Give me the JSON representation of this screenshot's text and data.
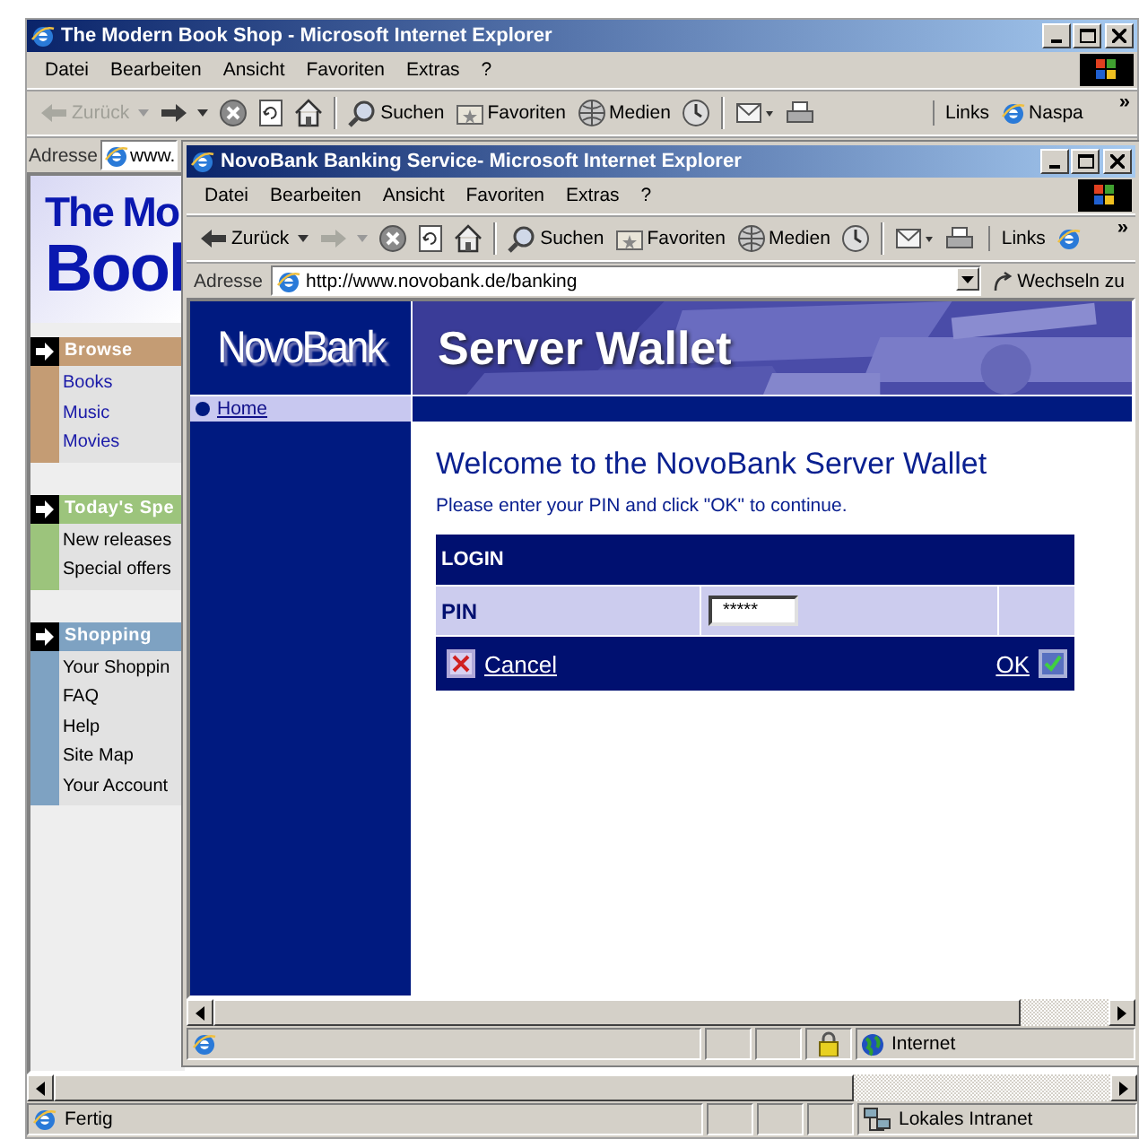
{
  "back_window": {
    "title": "The Modern Book Shop - Microsoft Internet Explorer",
    "menu": [
      "Datei",
      "Bearbeiten",
      "Ansicht",
      "Favoriten",
      "Extras",
      "?"
    ],
    "toolbar": [
      {
        "kind": "back",
        "label": "Zurück",
        "disabled": true
      },
      {
        "kind": "forward",
        "disabled": false
      },
      {
        "kind": "stop"
      },
      {
        "kind": "refresh"
      },
      {
        "kind": "home"
      },
      {
        "kind": "separator"
      },
      {
        "kind": "search",
        "label": "Suchen"
      },
      {
        "kind": "favorites",
        "label": "Favoriten"
      },
      {
        "kind": "media",
        "label": "Medien"
      },
      {
        "kind": "history"
      },
      {
        "kind": "separator"
      },
      {
        "kind": "mail"
      },
      {
        "kind": "print"
      }
    ],
    "links": {
      "label": "Links",
      "items": [
        "Naspa"
      ],
      "more": "»"
    },
    "address": {
      "label": "Adresse",
      "value": "www."
    },
    "page": {
      "logo": [
        "The Mo",
        "Bool"
      ],
      "sections": [
        {
          "title": "Browse",
          "color": "#c49c74",
          "links": true,
          "items": [
            "Books",
            "Music",
            "Movies"
          ]
        },
        {
          "title": "Today's Spe",
          "color": "#9cc47c",
          "links": false,
          "items": [
            "New releases",
            "Special offers"
          ]
        },
        {
          "title": "Shopping",
          "color": "#7ea2c2",
          "links": false,
          "items": [
            "Your Shoppin",
            "FAQ",
            "Help",
            "Site Map",
            "Your Account"
          ]
        }
      ]
    },
    "status": {
      "text": "Fertig",
      "zone": "Lokales Intranet",
      "kind": "intranet"
    }
  },
  "front_window": {
    "title": "NovoBank Banking Service- Microsoft Internet Explorer",
    "menu": [
      "Datei",
      "Bearbeiten",
      "Ansicht",
      "Favoriten",
      "Extras",
      "?"
    ],
    "toolbar": [
      {
        "kind": "back",
        "label": "Zurück",
        "disabled": false
      },
      {
        "kind": "forward",
        "disabled": true
      },
      {
        "kind": "stop"
      },
      {
        "kind": "refresh"
      },
      {
        "kind": "home"
      },
      {
        "kind": "separator"
      },
      {
        "kind": "search",
        "label": "Suchen"
      },
      {
        "kind": "favorites",
        "label": "Favoriten"
      },
      {
        "kind": "media",
        "label": "Medien"
      },
      {
        "kind": "history"
      },
      {
        "kind": "separator"
      },
      {
        "kind": "mail"
      },
      {
        "kind": "print"
      }
    ],
    "links": {
      "label": "Links",
      "more": "»"
    },
    "address": {
      "label": "Adresse",
      "value": "http://www.novobank.de/banking",
      "go": "Wechseln zu"
    },
    "page": {
      "logo": "NovoBank",
      "banner": "Server Wallet",
      "nav": [
        {
          "label": "Home"
        }
      ],
      "heading": "Welcome to the NovoBank Server Wallet",
      "instruction": "Please enter your PIN and click \"OK\" to continue.",
      "login": {
        "header": "LOGIN",
        "pin_label": "PIN",
        "pin_value": "*****",
        "cancel": "Cancel",
        "ok": "OK"
      }
    },
    "status": {
      "zone": "Internet",
      "kind": "internet",
      "secure": true
    }
  }
}
